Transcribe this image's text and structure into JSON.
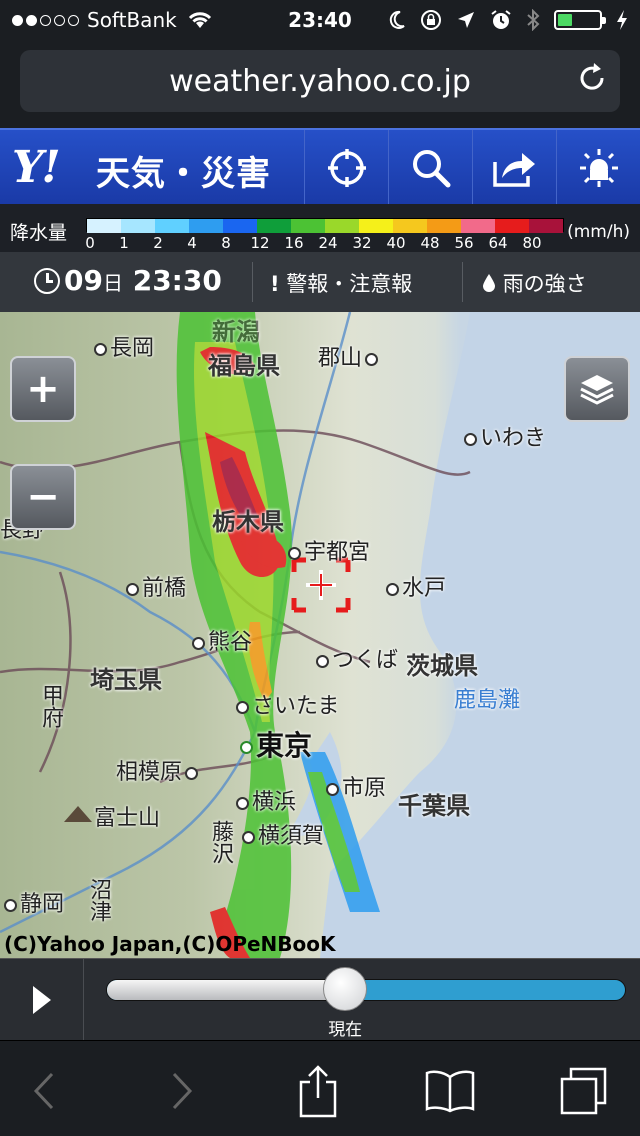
{
  "status_bar": {
    "carrier": "SoftBank",
    "signal_dots_filled": 2,
    "signal_dots_total": 5,
    "time": "23:40",
    "battery_level": 0.35
  },
  "url_bar": {
    "url": "weather.yahoo.co.jp"
  },
  "header": {
    "logo": "Y!",
    "brand": "天気・災害",
    "buttons": [
      "crosshair-icon",
      "search-icon",
      "share-icon",
      "weather-sun-icon"
    ]
  },
  "legend": {
    "label": "降水量",
    "unit": "(mm/h)",
    "ticks": [
      "0",
      "1",
      "2",
      "4",
      "8",
      "12",
      "16",
      "24",
      "32",
      "40",
      "48",
      "56",
      "64",
      "80"
    ],
    "colors": [
      "#d6f2ff",
      "#a6e6ff",
      "#60d0ff",
      "#2e9df0",
      "#1a66f0",
      "#0f9e3a",
      "#4cc234",
      "#9ad82a",
      "#f5f01a",
      "#f5c81e",
      "#f49b16",
      "#f26a8a",
      "#e61c1c",
      "#a8123a"
    ]
  },
  "time_bar": {
    "day": "09",
    "day_suffix": "日",
    "time": "23:30",
    "warnings_label": "警報・注意報",
    "rain_label": "雨の強さ"
  },
  "map": {
    "zoom_in_label": "+",
    "zoom_out_label": "−",
    "places": {
      "nagaoka": "長岡",
      "fukushima": "福島県",
      "koriyama": "郡山",
      "iwaki": "いわき",
      "nagano": "長野",
      "tochigi": "栃木県",
      "utsunomiya": "宇都宮",
      "maebashi": "前橋",
      "mito": "水戸",
      "kumagaya": "熊谷",
      "tsukuba": "つくば",
      "ibaraki": "茨城県",
      "saitama_pref": "埼玉県",
      "saitama": "さいたま",
      "kashima": "鹿島灘",
      "kofu": "甲府",
      "tokyo": "東京",
      "sagamihara": "相模原",
      "ichihara": "市原",
      "yokohama": "横浜",
      "chiba": "千葉県",
      "fuji": "富士山",
      "yokosuka": "横須賀",
      "fujisawa": "藤沢",
      "shizuoka": "静岡",
      "numazu": "沼津",
      "niigata": "新潟"
    },
    "copyright": "(C)Yahoo Japan,(C)OPeNBooK"
  },
  "player": {
    "now_label": "現在",
    "progress": 0.46
  },
  "toolbar": [
    "back-icon",
    "forward-icon",
    "share-icon",
    "bookmarks-icon",
    "tabs-icon"
  ]
}
